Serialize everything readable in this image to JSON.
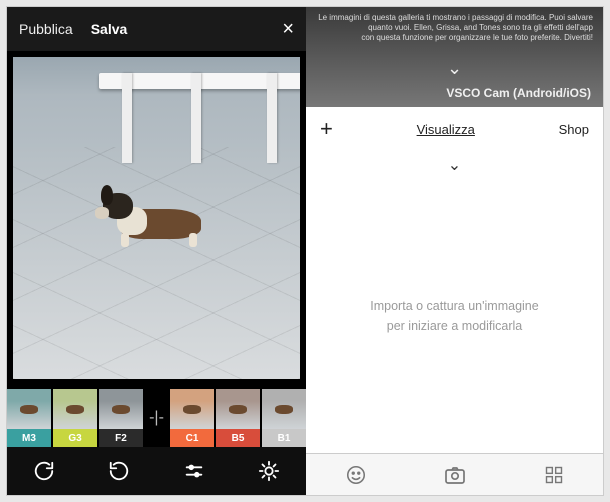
{
  "editor": {
    "publish_label": "Pubblica",
    "save_label": "Salva",
    "close_label": "×",
    "filters": [
      {
        "id": "M3",
        "label": "M3",
        "band_color": "#3aa0a0",
        "thumb_tint": "#7fa9a9"
      },
      {
        "id": "G3",
        "label": "G3",
        "band_color": "#c7d640",
        "thumb_tint": "#b7c78f"
      },
      {
        "id": "F2",
        "label": "F2",
        "band_color": "#2b2b2b",
        "thumb_tint": "#8e9599"
      },
      {
        "id": "C1",
        "label": "C1",
        "band_color": "#f26a3d",
        "thumb_tint": "#d3a27f"
      },
      {
        "id": "B5",
        "label": "B5",
        "band_color": "#d84d3b",
        "thumb_tint": "#a8968e"
      },
      {
        "id": "B1",
        "label": "B1",
        "band_color": "#c8c8c8",
        "thumb_tint": "#b0b0b0"
      }
    ],
    "separator_glyph": "-|-",
    "toolbar_icons": {
      "redo": "redo-icon",
      "undo": "undo-icon",
      "adjust": "sliders-icon",
      "presets": "gear-icon"
    }
  },
  "library": {
    "blurred_text_line1": "Le immagini di questa galleria ti mostrano i passaggi di modifica. Puoi salvare",
    "blurred_text_line2": "quanto vuoi. Ellen, Grissa, and Tones sono tra gli effetti dell'app",
    "blurred_text_line3": "con questa funzione per organizzare le tue foto preferite. Divertiti!",
    "app_name": "VSCO Cam (Android/iOS)",
    "tabs": {
      "view_label": "Visualizza",
      "shop_label": "Shop",
      "add_label": "+"
    },
    "empty_line1": "Importa o cattura un'immagine",
    "empty_line2": "per iniziare a modificarla",
    "bottom_icons": {
      "grid": "grid-icon",
      "camera": "camera-icon",
      "smile": "smile-icon"
    }
  }
}
